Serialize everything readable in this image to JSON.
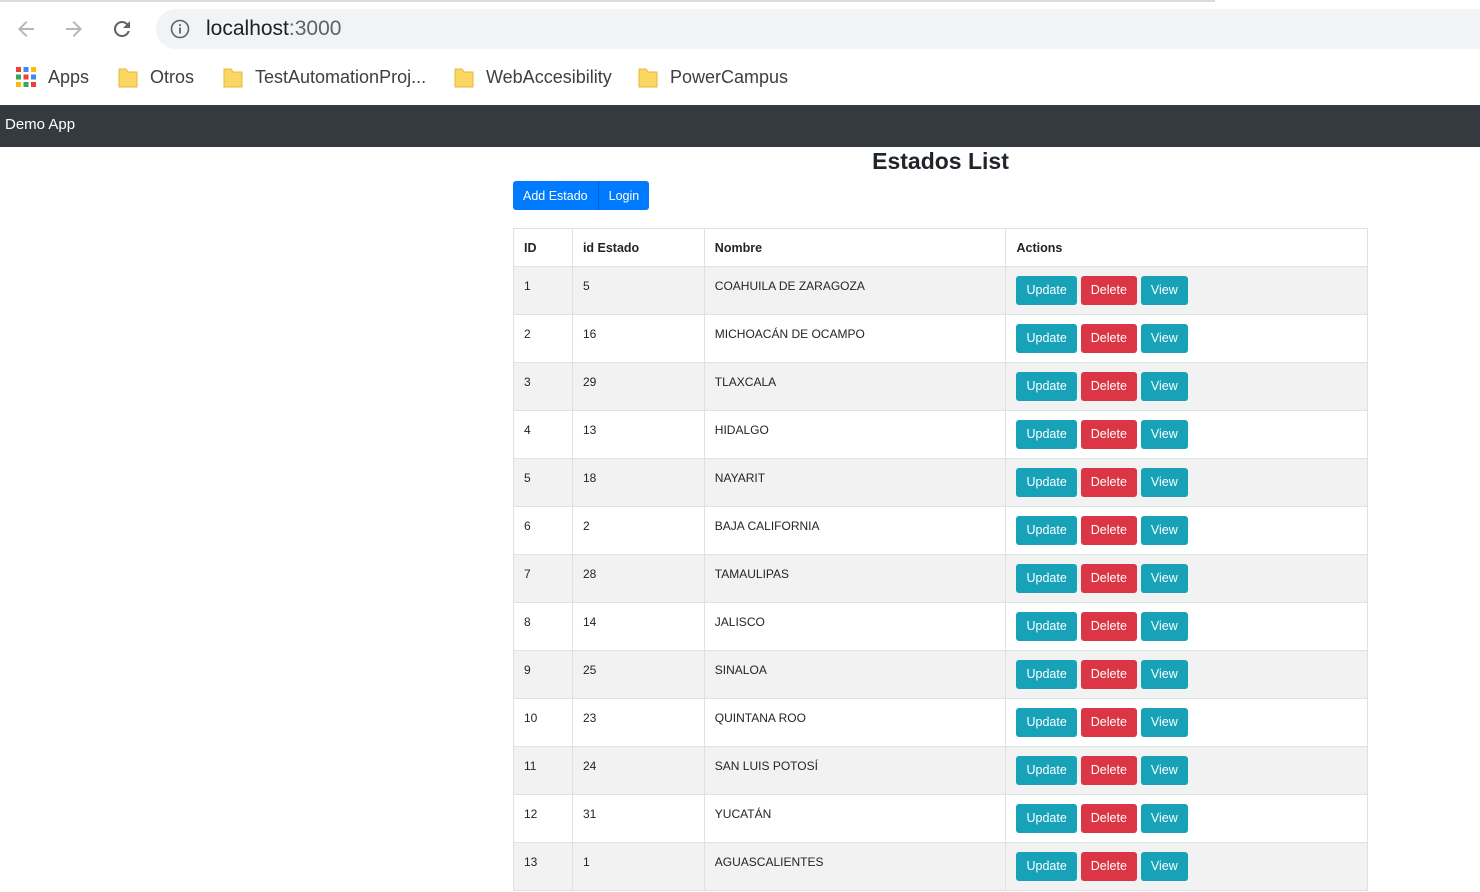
{
  "browser": {
    "url_host": "localhost",
    "url_port": ":3000",
    "bookmarks": [
      "Apps",
      "Otros",
      "TestAutomationProj...",
      "WebAccesibility",
      "PowerCampus"
    ]
  },
  "navbar": {
    "brand": "Demo App"
  },
  "page": {
    "title": "Estados List",
    "add_button": "Add Estado",
    "login_button": "Login"
  },
  "table": {
    "headers": [
      "ID",
      "id Estado",
      "Nombre",
      "Actions"
    ],
    "action_labels": {
      "update": "Update",
      "delete": "Delete",
      "view": "View"
    },
    "rows": [
      [
        "1",
        "5",
        "COAHUILA DE ZARAGOZA"
      ],
      [
        "2",
        "16",
        "MICHOACÁN DE OCAMPO"
      ],
      [
        "3",
        "29",
        "TLAXCALA"
      ],
      [
        "4",
        "13",
        "HIDALGO"
      ],
      [
        "5",
        "18",
        "NAYARIT"
      ],
      [
        "6",
        "2",
        "BAJA CALIFORNIA"
      ],
      [
        "7",
        "28",
        "TAMAULIPAS"
      ],
      [
        "8",
        "14",
        "JALISCO"
      ],
      [
        "9",
        "25",
        "SINALOA"
      ],
      [
        "10",
        "23",
        "QUINTANA ROO"
      ],
      [
        "11",
        "24",
        "SAN LUIS POTOSÍ"
      ],
      [
        "12",
        "31",
        "YUCATÁN"
      ],
      [
        "13",
        "1",
        "AGUASCALIENTES"
      ]
    ]
  },
  "colors": {
    "navbar": "#343a40",
    "primary": "#007bff",
    "info": "#17a2b8",
    "danger": "#dc3545"
  }
}
